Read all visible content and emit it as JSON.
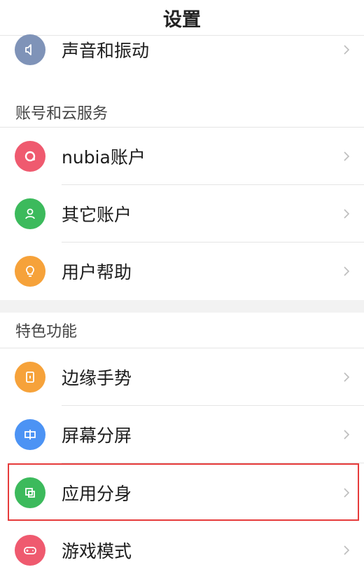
{
  "header": {
    "title": "设置"
  },
  "rows": {
    "sound": {
      "label": "声音和振动",
      "icon": "speaker-icon",
      "color": "#7f93b8"
    },
    "nubia": {
      "label": "nubia账户",
      "icon": "nubia-ring-icon",
      "color": "#ef5a6f"
    },
    "other": {
      "label": "其它账户",
      "icon": "person-icon",
      "color": "#3cba5c"
    },
    "help": {
      "label": "用户帮助",
      "icon": "lightbulb-icon",
      "color": "#f6a23a"
    },
    "edge": {
      "label": "边缘手势",
      "icon": "edge-gesture-icon",
      "color": "#f6a23a"
    },
    "split": {
      "label": "屏幕分屏",
      "icon": "split-screen-icon",
      "color": "#4c93f4"
    },
    "clone": {
      "label": "应用分身",
      "icon": "app-clone-icon",
      "color": "#3cba5c"
    },
    "game": {
      "label": "游戏模式",
      "icon": "gamepad-icon",
      "color": "#ef5a6f"
    }
  },
  "sections": {
    "account": {
      "title": "账号和云服务"
    },
    "features": {
      "title": "特色功能"
    }
  },
  "highlight_color": "#e63b3b"
}
